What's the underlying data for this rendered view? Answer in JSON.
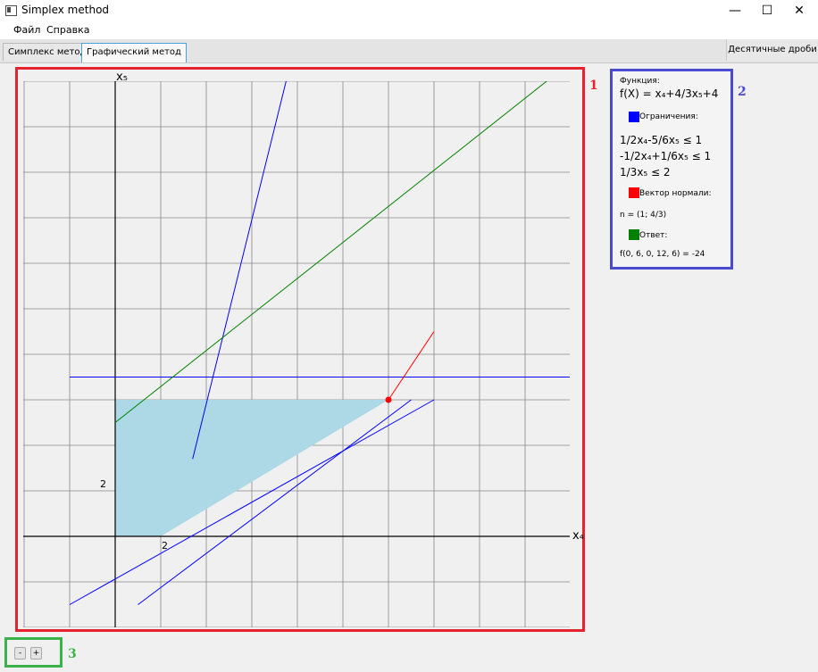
{
  "window": {
    "title": "Simplex method",
    "minimize": "—",
    "maximize": "☐",
    "close": "✕"
  },
  "menu": {
    "file": "Файл",
    "help": "Справка"
  },
  "tabs": {
    "simplex": "Симплекс метод",
    "graphic": "Графический метод"
  },
  "toolbar": {
    "fractions": "Десятичные дроби"
  },
  "badges": {
    "plot": "1",
    "legend": "2",
    "zoom": "3"
  },
  "legend": {
    "function_header": "Функция:",
    "function": "f(X) = x₄+4/3x₅+4",
    "constraints_header": "Ограничения:",
    "constraints": [
      "1/2x₄-5/6x₅ ≤ 1",
      "-1/2x₄+1/6x₅ ≤ 1",
      "1/3x₅ ≤ 2"
    ],
    "normal_header": "Вектор нормали:",
    "normal": "n = (1; 4/3)",
    "answer_header": "Ответ:",
    "answer": "f(0, 6, 0, 12, 6) = -24"
  },
  "zoom": {
    "minus": "-",
    "plus": "+"
  },
  "colors": {
    "constraints": "#0000ff",
    "normal": "#ff0000",
    "answer": "#008000",
    "feasible_region": "#add8e6",
    "plot_frame": "#e5232e",
    "legend_frame": "#4a4acf",
    "zoom_frame": "#3cb34a"
  },
  "chart_data": {
    "type": "line",
    "xlabel": "x₄",
    "ylabel": "x₅",
    "xlim": [
      0,
      20
    ],
    "ylim": [
      -3.5,
      20
    ],
    "tick_labels": {
      "x": "2",
      "y": "2"
    },
    "series": [
      {
        "points": [
          [
            -2,
            -3
          ],
          [
            14,
            6
          ]
        ]
      },
      {
        "points": [
          [
            -2,
            7
          ],
          [
            24,
            7
          ]
        ]
      },
      {
        "points": [
          [
            3.4,
            3.4
          ],
          [
            8,
            22
          ]
        ]
      },
      {
        "points": [
          [
            0,
            5
          ],
          [
            24,
            24
          ]
        ]
      },
      {
        "points": [
          [
            1,
            -3
          ],
          [
            13,
            6
          ]
        ]
      },
      {
        "points": [
          [
            12,
            6
          ],
          [
            14,
            9
          ]
        ]
      }
    ],
    "feasible_region": [
      [
        0,
        0
      ],
      [
        2,
        0
      ],
      [
        12,
        6
      ],
      [
        0,
        6
      ]
    ],
    "optimal_point": [
      12,
      6
    ]
  }
}
